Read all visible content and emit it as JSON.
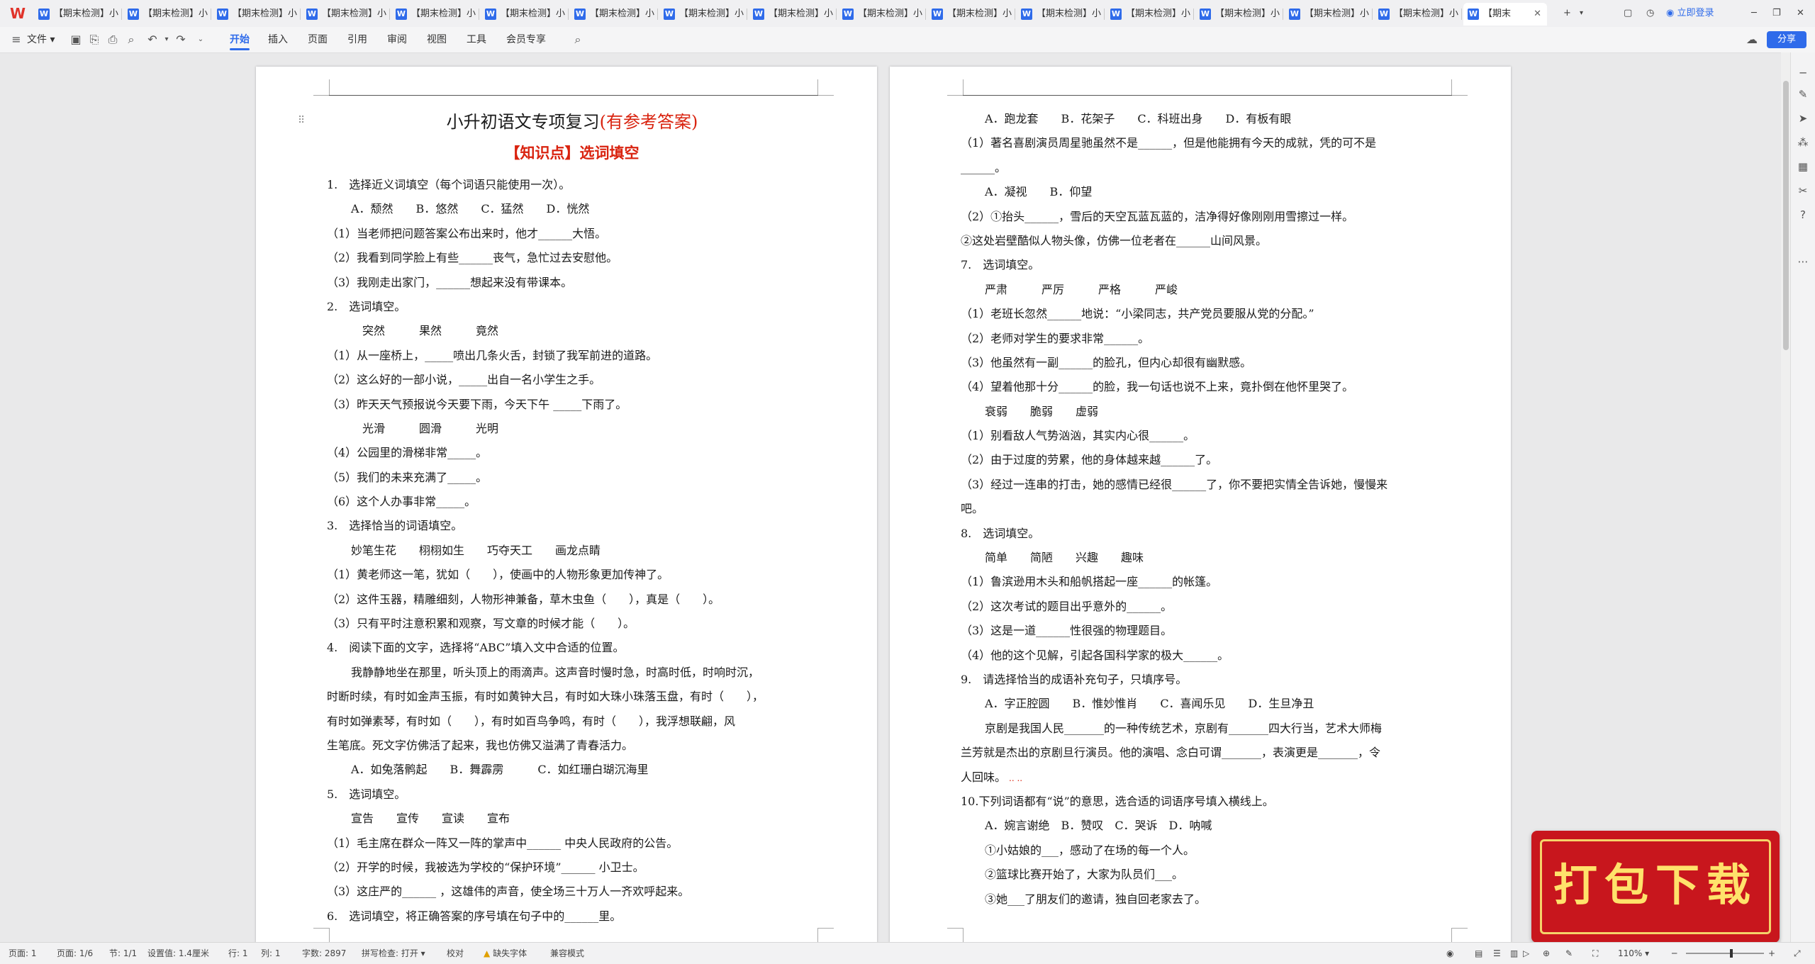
{
  "tabbar": {
    "tabs": [
      "【期末检测】小",
      "【期末检测】小",
      "【期末检测】小",
      "【期末检测】小",
      "【期末检测】小",
      "【期末检测】小",
      "【期末检测】小",
      "【期末检测】小",
      "【期末检测】小",
      "【期末检测】小",
      "【期末检测】小",
      "【期末检测】小",
      "【期末检测】小",
      "【期末检测】小",
      "【期末检测】小",
      "【期末检测】小",
      "【期末"
    ],
    "new_tab": "+",
    "login": "立即登录"
  },
  "toolbar": {
    "file": "文件",
    "menus": [
      "开始",
      "插入",
      "页面",
      "引用",
      "审阅",
      "视图",
      "工具",
      "会员专享"
    ],
    "share": "分享"
  },
  "page_left": {
    "title_black": "小升初语文专项复习",
    "title_red": "(有参考答案)",
    "heading": "【知识点】选词填空",
    "lines": [
      {
        "t": "1.　选择近义词填空（每个词语只能使用一次）。",
        "i": 0
      },
      {
        "t": "A．颓然　　B．悠然　　C．猛然　　D．恍然",
        "i": 1
      },
      {
        "t": "（1）当老师把问题答案公布出来时，他才______大悟。",
        "i": 0
      },
      {
        "t": "（2）我看到同学脸上有些______丧气，急忙过去安慰他。",
        "i": 0
      },
      {
        "t": "（3）我刚走出家门，______想起来没有带课本。",
        "i": 0
      },
      {
        "t": "2.　选词填空。",
        "i": 0
      },
      {
        "t": "突然　　　果然　　　竟然",
        "i": 2
      },
      {
        "t": "（1）从一座桥上，_____喷出几条火舌，封锁了我军前进的道路。",
        "i": 0
      },
      {
        "t": "（2）这么好的一部小说，_____出自一名小学生之手。",
        "i": 0
      },
      {
        "t": "（3）昨天天气预报说今天要下雨，今天下午 _____下雨了。",
        "i": 0
      },
      {
        "t": "光滑　　　圆滑　　　光明",
        "i": 2
      },
      {
        "t": "（4）公园里的滑梯非常_____。",
        "i": 0
      },
      {
        "t": "（5）我们的未来充满了_____。",
        "i": 0
      },
      {
        "t": "（6）这个人办事非常_____。",
        "i": 0
      },
      {
        "t": "3.　选择恰当的词语填空。",
        "i": 0
      },
      {
        "t": "妙笔生花　　栩栩如生　　巧夺天工　　画龙点睛",
        "i": 1
      },
      {
        "t": "（1）黄老师这一笔，犹如（　　），使画中的人物形象更加传神了。",
        "i": 0
      },
      {
        "t": "（2）这件玉器，精雕细刻，人物形神兼备，草木虫鱼（　　），真是（　　）。",
        "i": 0
      },
      {
        "t": "（3）只有平时注意积累和观察，写文章的时候才能（　　）。",
        "i": 0
      },
      {
        "t": "4.　阅读下面的文字，选择将“ABC”填入文中合适的位置。",
        "i": 0
      },
      {
        "t": "我静静地坐在那里，听头顶上的雨滴声。这声音时慢时急，时高时低，时响时沉，",
        "i": 1
      },
      {
        "t": "时断时续，有时如金声玉振，有时如黄钟大吕，有时如大珠小珠落玉盘，有时（　　），",
        "i": 0
      },
      {
        "t": "有时如弹素琴，有时如（　　），有时如百鸟争鸣，有时（　　），我浮想联翩，风",
        "i": 0
      },
      {
        "t": "生笔底。死文字仿佛活了起来，我也仿佛又溢满了青春活力。",
        "i": 0
      },
      {
        "t": "A．如兔落鹘起　　B．舞霹雳　　　C．如红珊白瑚沉海里",
        "i": 1
      },
      {
        "t": "5.　选词填空。",
        "i": 0
      },
      {
        "t": "宣告　　宣传　　宣读　　宣布",
        "i": 1
      },
      {
        "t": "（1）毛主席在群众一阵又一阵的掌声中______ 中央人民政府的公告。",
        "i": 0
      },
      {
        "t": "（2）开学的时候，我被选为学校的“保护环境”______ 小卫士。",
        "i": 0
      },
      {
        "t": "（3）这庄严的______ ，这雄伟的声音，使全场三十万人一齐欢呼起来。",
        "i": 0
      },
      {
        "t": "6.　选词填空，将正确答案的序号填在句子中的______里。",
        "i": 0
      }
    ]
  },
  "page_right": {
    "lines": [
      {
        "t": "A．跑龙套　　B．花架子　　C．科班出身　　D．有板有眼",
        "i": 1
      },
      {
        "t": "（1）著名喜剧演员周星驰虽然不是______，但是他能拥有今天的成就，凭的可不是",
        "i": 0
      },
      {
        "t": "______。",
        "i": 0
      },
      {
        "t": "A．凝视　　B．仰望",
        "i": 1
      },
      {
        "t": "（2）①抬头______，雪后的天空瓦蓝瓦蓝的，洁净得好像刚刚用雪擦过一样。",
        "i": 0
      },
      {
        "t": "②这处岩壁酷似人物头像，仿佛一位老者在______山间风景。",
        "i": 0
      },
      {
        "t": "7.　选词填空。",
        "i": 0
      },
      {
        "t": "严肃　　　严厉　　　严格　　　严峻",
        "i": 1
      },
      {
        "t": "（1）老班长忽然______地说：“小梁同志，共产党员要服从党的分配。”",
        "i": 0
      },
      {
        "t": "（2）老师对学生的要求非常______。",
        "i": 0
      },
      {
        "t": "（3）他虽然有一副______的脸孔，但内心却很有幽默感。",
        "i": 0
      },
      {
        "t": "（4）望着他那十分______的脸，我一句话也说不上来，竟扑倒在他怀里哭了。",
        "i": 0
      },
      {
        "t": "衰弱　　脆弱　　虚弱",
        "i": 1
      },
      {
        "t": "（1）别看敌人气势汹汹，其实内心很______。",
        "i": 0
      },
      {
        "t": "（2）由于过度的劳累，他的身体越来越______了。",
        "i": 0
      },
      {
        "t": "（3）经过一连串的打击，她的感情已经很______了，你不要把实情全告诉她，慢慢来",
        "i": 0
      },
      {
        "t": "吧。",
        "i": 0
      },
      {
        "t": "8.　选词填空。",
        "i": 0
      },
      {
        "t": "简单　　简陋　　兴趣　　趣味",
        "i": 1
      },
      {
        "t": "（1）鲁滨逊用木头和船帆搭起一座______的帐篷。",
        "i": 0
      },
      {
        "t": "（2）这次考试的题目出乎意外的______。",
        "i": 0
      },
      {
        "t": "（3）这是一道______性很强的物理题目。",
        "i": 0
      },
      {
        "t": "（4）他的这个见解，引起各国科学家的极大______。",
        "i": 0
      },
      {
        "t": "9.　请选择恰当的成语补充句子，只填序号。",
        "i": 0
      },
      {
        "t": "A．字正腔圆　　B．惟妙惟肖　　C．喜闻乐见　　D．生旦净丑",
        "i": 1
      },
      {
        "t": "京剧是我国人民_______的一种传统艺术，京剧有_______四大行当，艺术大师梅",
        "i": 1
      },
      {
        "t": "兰芳就是杰出的京剧旦行演员。他的演唱、念白可谓_______，表演更是_______，令",
        "i": 0
      },
      {
        "t": "人回味。",
        "i": 0,
        "squiggle": true
      },
      {
        "t": "10.下列词语都有“说”的意思，选合适的词语序号填入横线上。",
        "i": 0
      },
      {
        "t": "A．婉言谢绝　B．赞叹　C．哭诉　D．呐喊",
        "i": 1
      },
      {
        "t": "①小姑娘的___，感动了在场的每一个人。",
        "i": 1
      },
      {
        "t": "②篮球比赛开始了，大家为队员们___。",
        "i": 1
      },
      {
        "t": "③她___了朋友们的邀请，独自回老家去了。",
        "i": 1
      }
    ]
  },
  "statusbar": {
    "page": "页面: 1",
    "pages": "页面: 1/6",
    "section": "节: 1/1",
    "setting": "设置值: 1.4厘米",
    "row": "行: 1",
    "col": "列: 1",
    "words": "字数: 2897",
    "spell": "拼写检查: 打开",
    "proof": "校对",
    "missing_font": "缺失字体",
    "compat": "兼容模式",
    "zoom": "110%"
  },
  "promo": {
    "text": "打包下载"
  },
  "colors": {
    "accent": "#2f6bea",
    "red": "#d9230f",
    "promo_bg": "#c8161d",
    "promo_text": "#ffe26b"
  }
}
